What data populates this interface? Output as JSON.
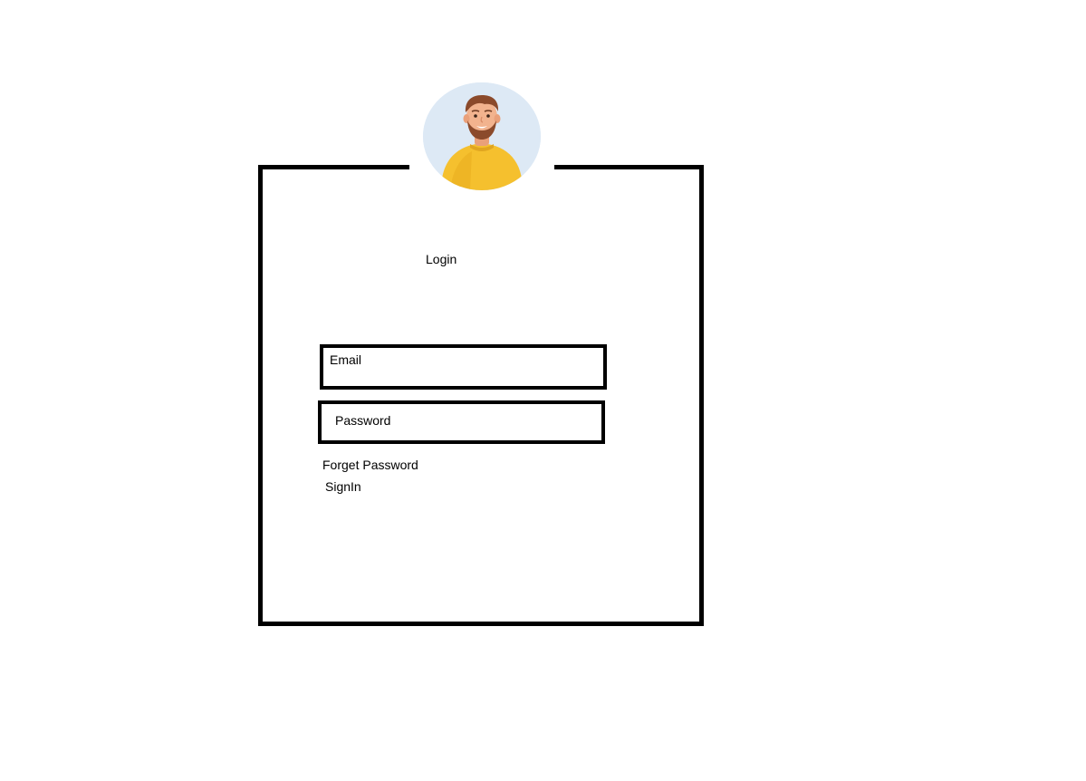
{
  "form": {
    "title": "Login",
    "email_label": "Email",
    "password_label": "Password",
    "forget_password_label": "Forget Password",
    "signin_label": "SignIn"
  },
  "avatar": {
    "icon": "user-avatar-icon",
    "background_color": "#dde9f5",
    "shirt_color": "#f5c02e"
  }
}
